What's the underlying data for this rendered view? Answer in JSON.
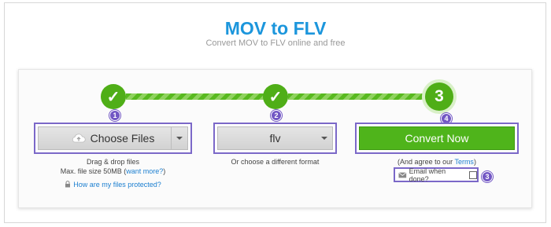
{
  "header": {
    "title": "MOV to FLV",
    "subtitle": "Convert MOV to FLV online and free"
  },
  "steps": {
    "step1_symbol": "✓",
    "step2_symbol": "✓",
    "step3_symbol": "3"
  },
  "markers": {
    "m1": "1",
    "m2": "2",
    "m3": "3",
    "m4": "4"
  },
  "choose_files": {
    "label": "Choose Files",
    "drag_text": "Drag & drop files",
    "max_size_text": "Max. file size 50MB (",
    "want_more_link": "want more?",
    "max_size_close": ")",
    "protect_link": "How are my files protected?"
  },
  "format": {
    "selected": "flv",
    "hint": "Or choose a different format"
  },
  "convert": {
    "label": "Convert Now",
    "terms_prefix": "(And agree to our ",
    "terms_link": "Terms",
    "terms_suffix": ")",
    "email_label": "Email when done?"
  },
  "colors": {
    "title_blue": "#1c96dc",
    "step_green": "#4fae17",
    "highlight_purple": "#7b68c8",
    "link_blue": "#1c7fd0"
  },
  "icons": {
    "check": "check-icon",
    "upload": "cloud-upload-icon",
    "lock": "lock-icon",
    "mail": "envelope-icon",
    "dropdown": "chevron-down-icon"
  }
}
